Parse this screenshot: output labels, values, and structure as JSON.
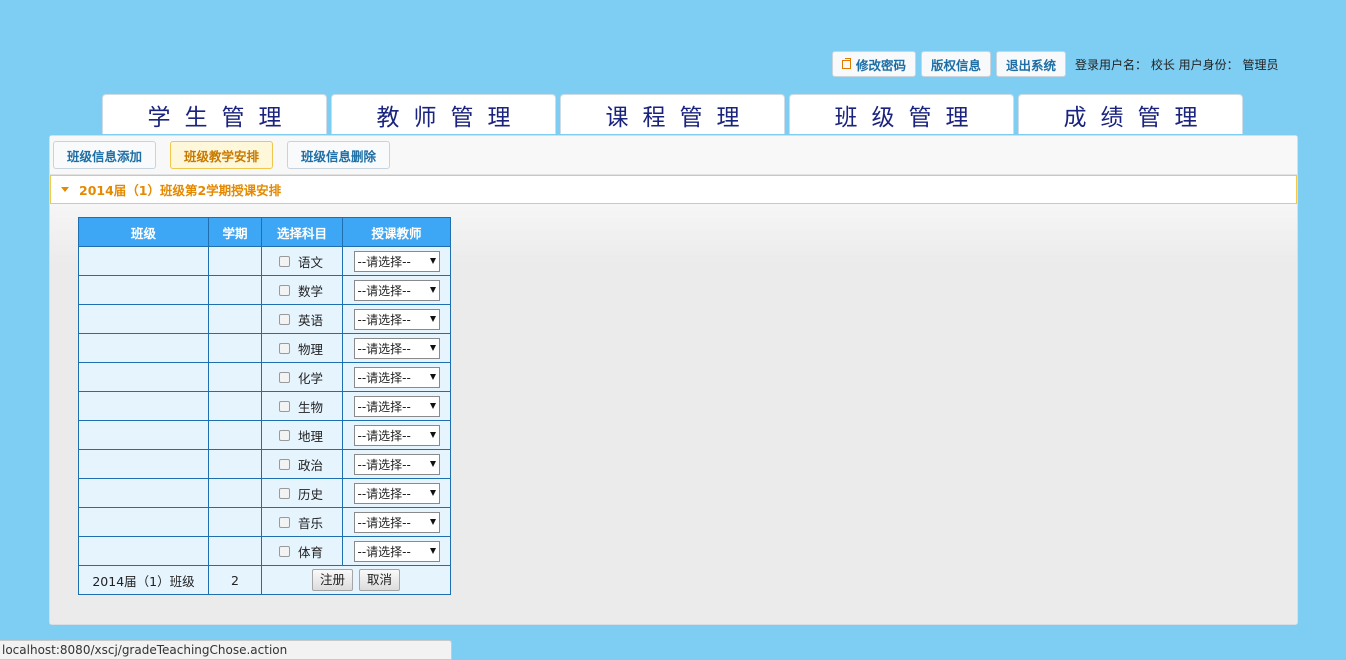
{
  "topbar": {
    "change_password": "修改密码",
    "copyright": "版权信息",
    "logout": "退出系统",
    "user_info": "登录用户名： 校长 用户身份： 管理员"
  },
  "nav": [
    "学生管理",
    "教师管理",
    "课程管理",
    "班级管理",
    "成绩管理"
  ],
  "subnav": {
    "add": "班级信息添加",
    "arrange": "班级教学安排",
    "delete": "班级信息删除"
  },
  "section_title": "2014届（1）班级第2学期授课安排",
  "table": {
    "headers": [
      "班级",
      "学期",
      "选择科目",
      "授课教师"
    ],
    "subjects": [
      "语文",
      "数学",
      "英语",
      "物理",
      "化学",
      "生物",
      "地理",
      "政治",
      "历史",
      "音乐",
      "体育"
    ],
    "teacher_placeholder": "--请选择--",
    "class_name": "2014届（1）班级",
    "term": "2",
    "submit_label": "注册",
    "cancel_label": "取消"
  },
  "status_url": "localhost:8080/xscj/gradeTeachingChose.action"
}
